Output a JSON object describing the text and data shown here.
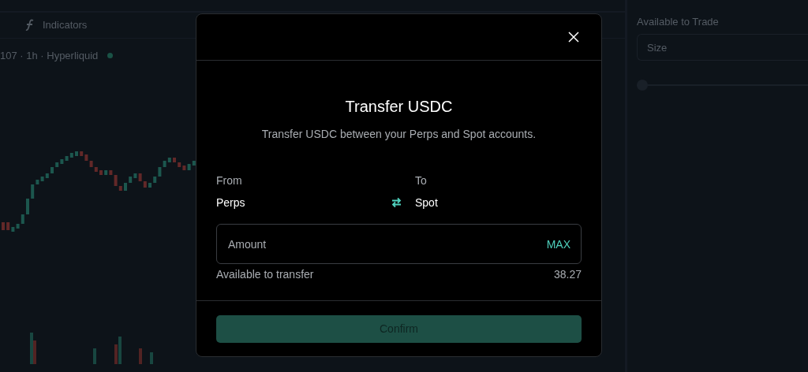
{
  "background": {
    "toolbar_button": "Indicators",
    "chart_title": "107 · 1h · Hyperliquid",
    "trade_panel": {
      "label": "Available to Trade",
      "size_placeholder": "Size",
      "slider": {
        "level": 0
      }
    }
  },
  "dialog": {
    "title": "Transfer USDC",
    "subtitle": "Transfer USDC between your Perps and Spot accounts.",
    "from": {
      "label": "From",
      "value": "Perps"
    },
    "to": {
      "label": "To",
      "value": "Spot"
    },
    "amount": {
      "placeholder": "Amount",
      "max_label": "MAX"
    },
    "available": {
      "label": "Available to transfer",
      "value": "38.27"
    },
    "confirm": {
      "label": "Confirm",
      "disabled": true
    }
  }
}
